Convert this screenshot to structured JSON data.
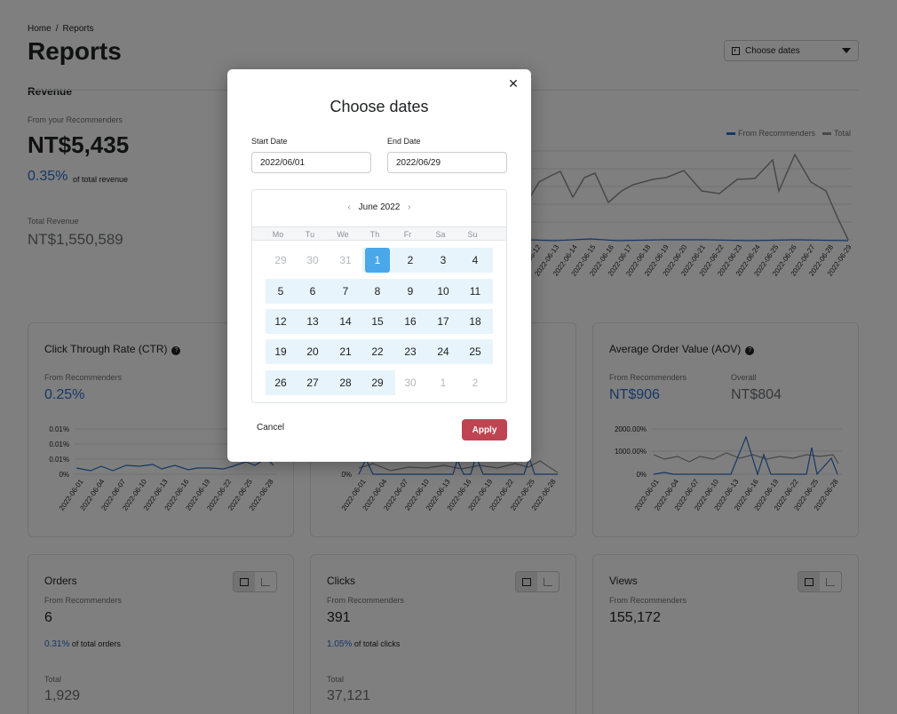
{
  "breadcrumb": {
    "home": "Home",
    "separator": "/",
    "current": "Reports"
  },
  "page_title": "Reports",
  "date_select": {
    "label": "Choose dates",
    "icon": "calendar-icon"
  },
  "revenue": {
    "section_label": "Revenue",
    "from_label": "From your Recommenders",
    "amount": "NT$5,435",
    "pct": "0.35%",
    "pct_label": "of total revenue",
    "total_label": "Total Revenue",
    "total": "NT$1,550,589",
    "legend": [
      "From Recommenders",
      "Total"
    ],
    "x_labels": [
      "2022-06-12",
      "2022-06-13",
      "2022-06-14",
      "2022-06-15",
      "2022-06-16",
      "2022-06-17",
      "2022-06-18",
      "2022-06-19",
      "2022-06-20",
      "2022-06-21",
      "2022-06-22",
      "2022-06-23",
      "2022-06-24",
      "2022-06-25",
      "2022-06-26",
      "2022-06-27",
      "2022-06-28",
      "2022-06-29"
    ]
  },
  "ctr": {
    "title": "Click Through Rate (CTR)",
    "from_label": "From Recommenders",
    "value": "0.25%",
    "y_ticks": [
      "0.01%",
      "0.01%",
      "0.01%",
      "0%"
    ],
    "x_labels": [
      "2022-06-01",
      "2022-06-04",
      "2022-06-07",
      "2022-06-10",
      "2022-06-13",
      "2022-06-16",
      "2022-06-19",
      "2022-06-22",
      "2022-06-25",
      "2022-06-28"
    ]
  },
  "middle": {
    "y_ticks": [
      "0%"
    ],
    "x_labels": [
      "2022-06-01",
      "2022-06-04",
      "2022-06-07",
      "2022-06-10",
      "2022-06-13",
      "2022-06-16",
      "2022-06-19",
      "2022-06-22",
      "2022-06-25",
      "2022-06-28"
    ]
  },
  "aov": {
    "title": "Average Order Value (AOV)",
    "from_label": "From Recommenders",
    "value": "NT$906",
    "overall_label": "Overall",
    "overall_value": "NT$804",
    "y_ticks": [
      "2000.00%",
      "1000.00%",
      "0%"
    ],
    "x_labels": [
      "2022-06-01",
      "2022-06-04",
      "2022-06-07",
      "2022-06-10",
      "2022-06-13",
      "2022-06-16",
      "2022-06-19",
      "2022-06-22",
      "2022-06-25",
      "2022-06-28"
    ]
  },
  "orders": {
    "title": "Orders",
    "from_label": "From Recommenders",
    "value": "6",
    "pct": "0.31%",
    "pct_label": "of total orders",
    "total_label": "Total",
    "total": "1,929"
  },
  "clicks": {
    "title": "Clicks",
    "from_label": "From Recommenders",
    "value": "391",
    "pct": "1.05%",
    "pct_label": "of total clicks",
    "total_label": "Total",
    "total": "37,121"
  },
  "views": {
    "title": "Views",
    "from_label": "From Recommenders",
    "value": "155,172"
  },
  "modal": {
    "title": "Choose dates",
    "close": "✕",
    "start_label": "Start Date",
    "start_value": "2022/06/01",
    "end_label": "End Date",
    "end_value": "2022/06/29",
    "month": "June 2022",
    "prev": "‹",
    "next": "›",
    "weekdays": [
      "Mo",
      "Tu",
      "We",
      "Th",
      "Fr",
      "Sa",
      "Su"
    ],
    "weeks": [
      [
        "29",
        "30",
        "31",
        "1",
        "2",
        "3",
        "4"
      ],
      [
        "5",
        "6",
        "7",
        "8",
        "9",
        "10",
        "11"
      ],
      [
        "12",
        "13",
        "14",
        "15",
        "16",
        "17",
        "18"
      ],
      [
        "19",
        "20",
        "21",
        "22",
        "23",
        "24",
        "25"
      ],
      [
        "26",
        "27",
        "28",
        "29",
        "30",
        "1",
        "2"
      ]
    ],
    "cancel": "Cancel",
    "apply": "Apply"
  },
  "colors": {
    "primary_blue": "#2c6ecb",
    "selected": "#4aa8ea",
    "range": "#e8f4fb",
    "apply": "#bf4452",
    "series_total": "#8c9196"
  }
}
